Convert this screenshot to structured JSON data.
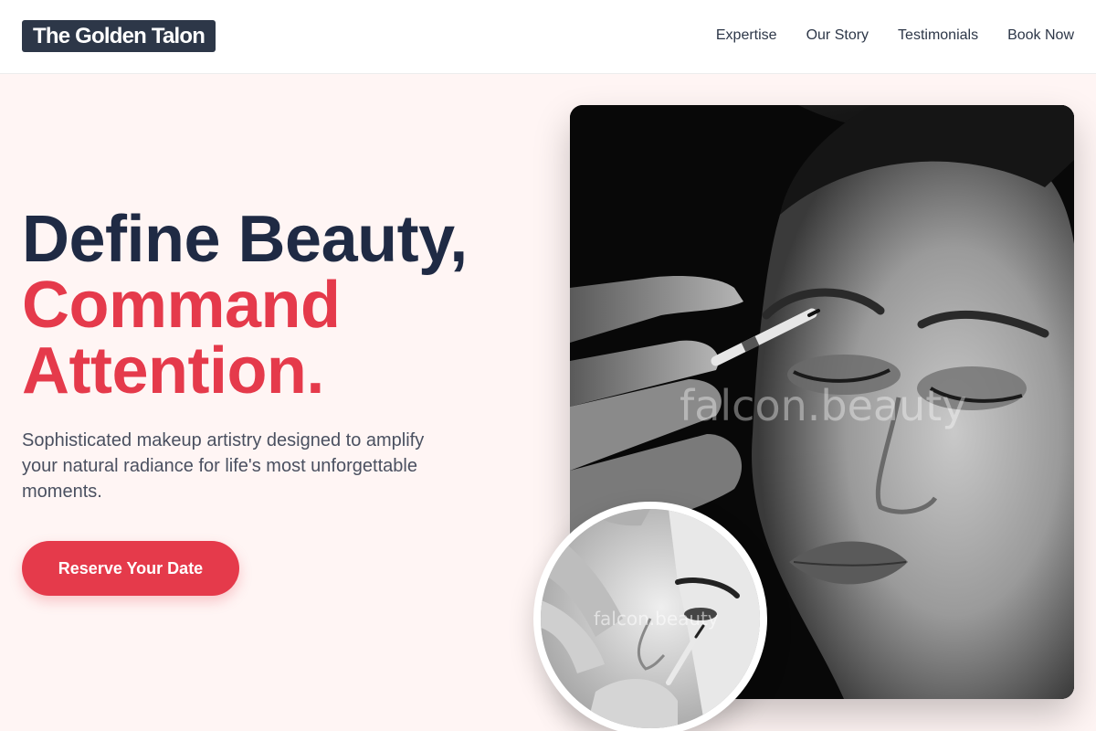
{
  "brand": {
    "logo_text": "The Golden Talon"
  },
  "nav": {
    "items": [
      {
        "label": "Expertise"
      },
      {
        "label": "Our Story"
      },
      {
        "label": "Testimonials"
      },
      {
        "label": "Book Now"
      }
    ]
  },
  "hero": {
    "headline_line1": "Define Beauty,",
    "headline_line2": "Command",
    "headline_line3": "Attention.",
    "subtitle": "Sophisticated makeup artistry designed to amplify your natural radiance for life's most unforgettable moments.",
    "cta_label": "Reserve Your Date",
    "main_image_watermark": "falcon.beauty",
    "inset_image_watermark": "falcon.beauty"
  },
  "colors": {
    "accent": "#e53a4b",
    "dark": "#1f2a44",
    "logo_bg": "#2d3748",
    "hero_bg": "#fff5f4"
  }
}
